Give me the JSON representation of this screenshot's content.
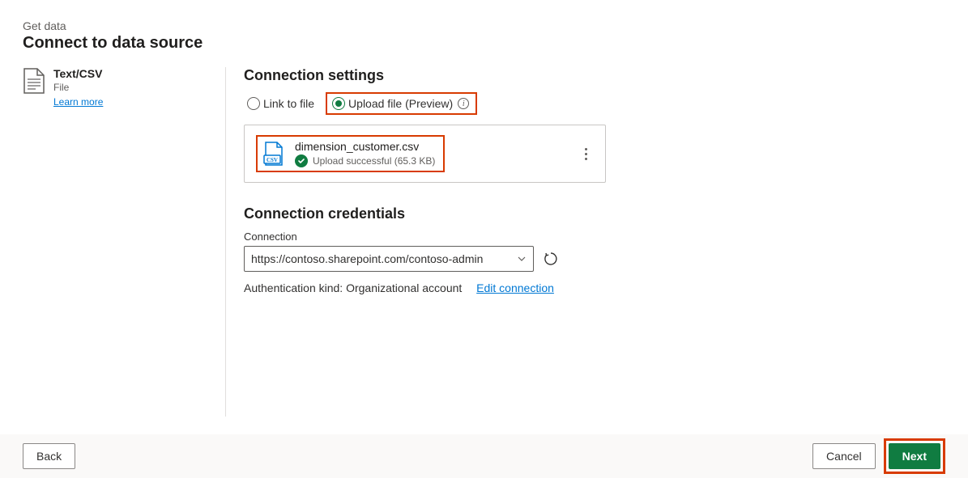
{
  "header": {
    "breadcrumb": "Get data",
    "title": "Connect to data source"
  },
  "sidebar": {
    "source_title": "Text/CSV",
    "source_subtitle": "File",
    "learn_more": "Learn more"
  },
  "settings": {
    "title": "Connection settings",
    "radio_link": "Link to file",
    "radio_upload": "Upload file (Preview)",
    "file": {
      "name": "dimension_customer.csv",
      "status": "Upload successful (65.3 KB)"
    }
  },
  "credentials": {
    "title": "Connection credentials",
    "connection_label": "Connection",
    "connection_value": "https://contoso.sharepoint.com/contoso-admin",
    "auth_kind": "Authentication kind: Organizational account",
    "edit_link": "Edit connection"
  },
  "footer": {
    "back": "Back",
    "cancel": "Cancel",
    "next": "Next"
  },
  "colors": {
    "accent": "#107c41",
    "highlight": "#d83b01",
    "link": "#0078d4"
  }
}
